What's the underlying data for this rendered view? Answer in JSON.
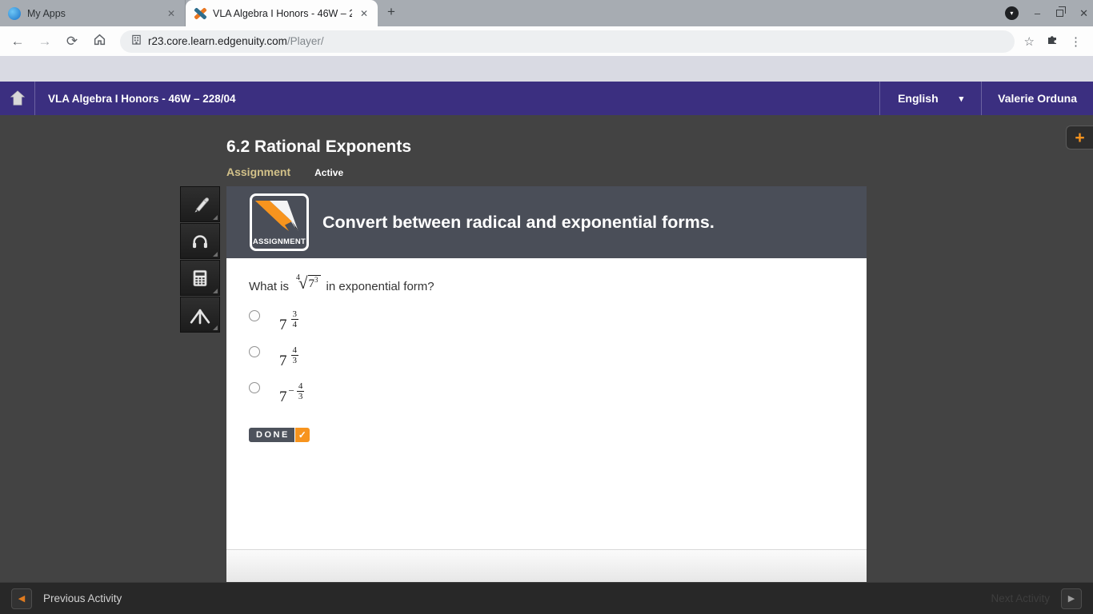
{
  "browser": {
    "tabs": [
      {
        "title": "My Apps"
      },
      {
        "title": "VLA Algebra I Honors - 46W – 2"
      }
    ],
    "new_tab_glyph": "+",
    "close_glyph": "✕",
    "window": {
      "profile_chevron": "▾",
      "minimize": "–",
      "close": "✕"
    },
    "nav": {
      "back": "←",
      "forward": "→",
      "reload": "⟳"
    },
    "omnibox": {
      "host": "r23.core.learn.edgenuity.com",
      "path": "/Player/"
    },
    "actions": {
      "bookmark": "☆",
      "menu": "⋮"
    }
  },
  "app_header": {
    "course_title": "VLA Algebra I Honors - 46W – 228/04",
    "language_label": "English",
    "language_chevron": "▾",
    "user_name": "Valerie Orduna"
  },
  "lesson": {
    "title": "6.2 Rational Exponents",
    "type_label": "Assignment",
    "status_label": "Active"
  },
  "side_tab": {
    "plus_glyph": "+"
  },
  "activity": {
    "badge_label": "ASSIGNMENT",
    "prompt_title": "Convert between radical and exponential forms.",
    "question": {
      "prefix": "What is",
      "root_index": "4",
      "radical_sign": "√",
      "base": "7",
      "exponent": "3",
      "suffix": "in exponential form?"
    },
    "options": [
      {
        "base": "7",
        "sign": "",
        "numerator": "3",
        "denominator": "4"
      },
      {
        "base": "7",
        "sign": "",
        "numerator": "4",
        "denominator": "3"
      },
      {
        "base": "7",
        "sign": "−",
        "numerator": "4",
        "denominator": "3"
      }
    ],
    "done": {
      "label": "DONE",
      "check_glyph": "✓"
    }
  },
  "footer_nav": {
    "previous_label": "Previous Activity",
    "previous_arrow": "◀",
    "next_label": "Next Activity",
    "next_arrow": "▶"
  },
  "colors": {
    "accent_orange": "#F7941E",
    "purple_header": "#3B2F80",
    "slate_header": "#4A4E58",
    "khaki_label": "#D2C189",
    "page_dark": "#434343"
  }
}
